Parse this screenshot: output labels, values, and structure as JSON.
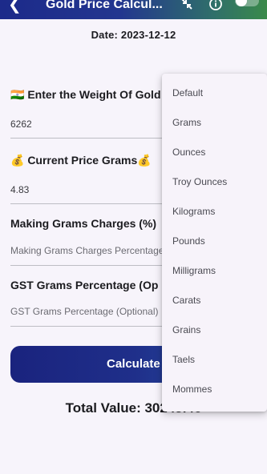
{
  "appbar": {
    "back_icon": "arrow-back-icon",
    "title": "Gold Price Calcul...",
    "icons": [
      "fullscreen-exit-icon",
      "info-icon",
      "theme-toggle"
    ]
  },
  "date_text": "Date: 2023-12-12",
  "fields": {
    "weight": {
      "label": "🇮🇳 Enter the Weight Of Gold",
      "value": "6262"
    },
    "price": {
      "label": "💰 Current Price Grams💰",
      "value": "4.83"
    },
    "making": {
      "label": "Making Grams Charges (%)",
      "placeholder": "Making Grams Charges Percentage"
    },
    "gst": {
      "label": "GST Grams Percentage (Op",
      "placeholder": "GST Grams Percentage (Optional)"
    }
  },
  "calculate_label": "Calculate",
  "total_text": "Total Value: 30245.46",
  "unit_menu": {
    "items": [
      "Default",
      "Grams",
      "Ounces",
      "Troy Ounces",
      "Kilograms",
      "Pounds",
      "Milligrams",
      "Carats",
      "Grains",
      "Taels",
      "Mommes"
    ]
  },
  "colors": {
    "appbar_start": "#1c2a8a",
    "appbar_end": "#3a8a4a",
    "button": "#1a237e"
  }
}
